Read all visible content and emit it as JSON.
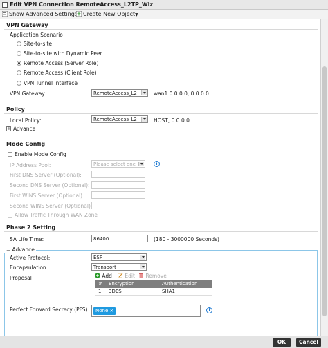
{
  "window": {
    "title": "Edit VPN Connection RemoteAccess_L2TP_Wiz"
  },
  "toolbar": {
    "show_advanced": "Show Advanced Settings",
    "create_new": "Create New Object",
    "create_new_arrow": "▼"
  },
  "vpn_gateway": {
    "section_title": "VPN Gateway",
    "scenario_label": "Application Scenario",
    "options": [
      "Site-to-site",
      "Site-to-site with Dynamic Peer",
      "Remote Access (Server Role)",
      "Remote Access (Client Role)",
      "VPN Tunnel Interface"
    ],
    "selected_index": 2,
    "gateway_label": "VPN Gateway:",
    "gateway_value": "RemoteAccess_L2",
    "gateway_info": "wan1  0.0.0.0, 0.0.0.0"
  },
  "policy": {
    "section_title": "Policy",
    "local_label": "Local Policy:",
    "local_value": "RemoteAccess_L2",
    "local_info": "HOST, 0.0.0.0",
    "advance_label": "Advance",
    "advance_toggle": "+"
  },
  "mode_config": {
    "section_title": "Mode Config",
    "enable_label": "Enable Mode Config",
    "ip_pool_label": "IP Address Pool:",
    "ip_pool_placeholder": "Please select one",
    "info_glyph": "i",
    "first_dns_label": "First DNS Server (Optional):",
    "second_dns_label": "Second DNS Server (Optional):",
    "first_wins_label": "First WINS Server (Optional):",
    "second_wins_label": "Second WINS Server (Optional):",
    "allow_wan_label": "Allow Traffic Through WAN Zone"
  },
  "phase2": {
    "section_title": "Phase 2 Setting",
    "sa_life_label": "SA Life Time:",
    "sa_life_value": "86400",
    "sa_life_range": "(180 - 3000000 Seconds)",
    "advance_label": "Advance",
    "advance_toggle": "−",
    "active_protocol_label": "Active Protocol:",
    "active_protocol_value": "ESP",
    "encapsulation_label": "Encapsulation:",
    "encapsulation_value": "Transport",
    "proposal_label": "Proposal",
    "proposal_actions": {
      "add": "Add",
      "edit": "Edit",
      "remove": "Remove"
    },
    "proposal_table": {
      "headers": [
        "#",
        "Encryption",
        "Authentication"
      ],
      "rows": [
        [
          "1",
          "3DES",
          "SHA1"
        ]
      ]
    },
    "pfs_label": "Perfect Forward Secrecy (PFS):",
    "pfs_value": "None",
    "pfs_remove": "×"
  },
  "footer": {
    "ok": "OK",
    "cancel": "Cancel"
  },
  "colors": {
    "accent": "#1f9ae0",
    "fieldset_border": "#8cc6e8",
    "button_bg": "#333333"
  }
}
